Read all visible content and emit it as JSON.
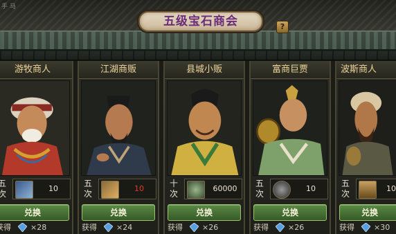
{
  "header": {
    "title": "五级宝石商会",
    "help_label": "?",
    "corner_text": "手 马"
  },
  "colors": {
    "title_text": "#6b2c7a",
    "name_text": "#efd59a",
    "button_green": "#4a7a37",
    "cost_red": "#e03a2a",
    "cost_white": "#e8e3d4"
  },
  "cards": [
    {
      "name": "游牧商人",
      "times": "五次",
      "item_icon": "scroll-icon",
      "cost": "10",
      "cost_color": "#e8e3d4",
      "button": "兑换",
      "gain_label": "获得",
      "gain_icon": "blue-gem-icon",
      "gain_count": "×28"
    },
    {
      "name": "江湖商贩",
      "times": "五次",
      "item_icon": "scroll-icon",
      "cost": "10",
      "cost_color": "#e03a2a",
      "button": "兑换",
      "gain_label": "获得",
      "gain_icon": "blue-gem-icon",
      "gain_count": "×24"
    },
    {
      "name": "县城小贩",
      "times": "十次",
      "item_icon": "herb-icon",
      "cost": "60000",
      "cost_color": "#e8e3d4",
      "button": "兑换",
      "gain_label": "获得",
      "gain_icon": "blue-gem-icon",
      "gain_count": "×26"
    },
    {
      "name": "富商巨贾",
      "times": "五次",
      "item_icon": "stone-icon",
      "cost": "10",
      "cost_color": "#e8e3d4",
      "button": "兑换",
      "gain_label": "获得",
      "gain_icon": "blue-gem-icon",
      "gain_count": "×26"
    },
    {
      "name": "波斯商人",
      "times": "五次",
      "item_icon": "jar-icon",
      "cost": "10",
      "cost_color": "#e8e3d4",
      "button": "兑换",
      "gain_label": "获得",
      "gain_icon": "blue-gem-icon",
      "gain_count": "×30"
    }
  ]
}
